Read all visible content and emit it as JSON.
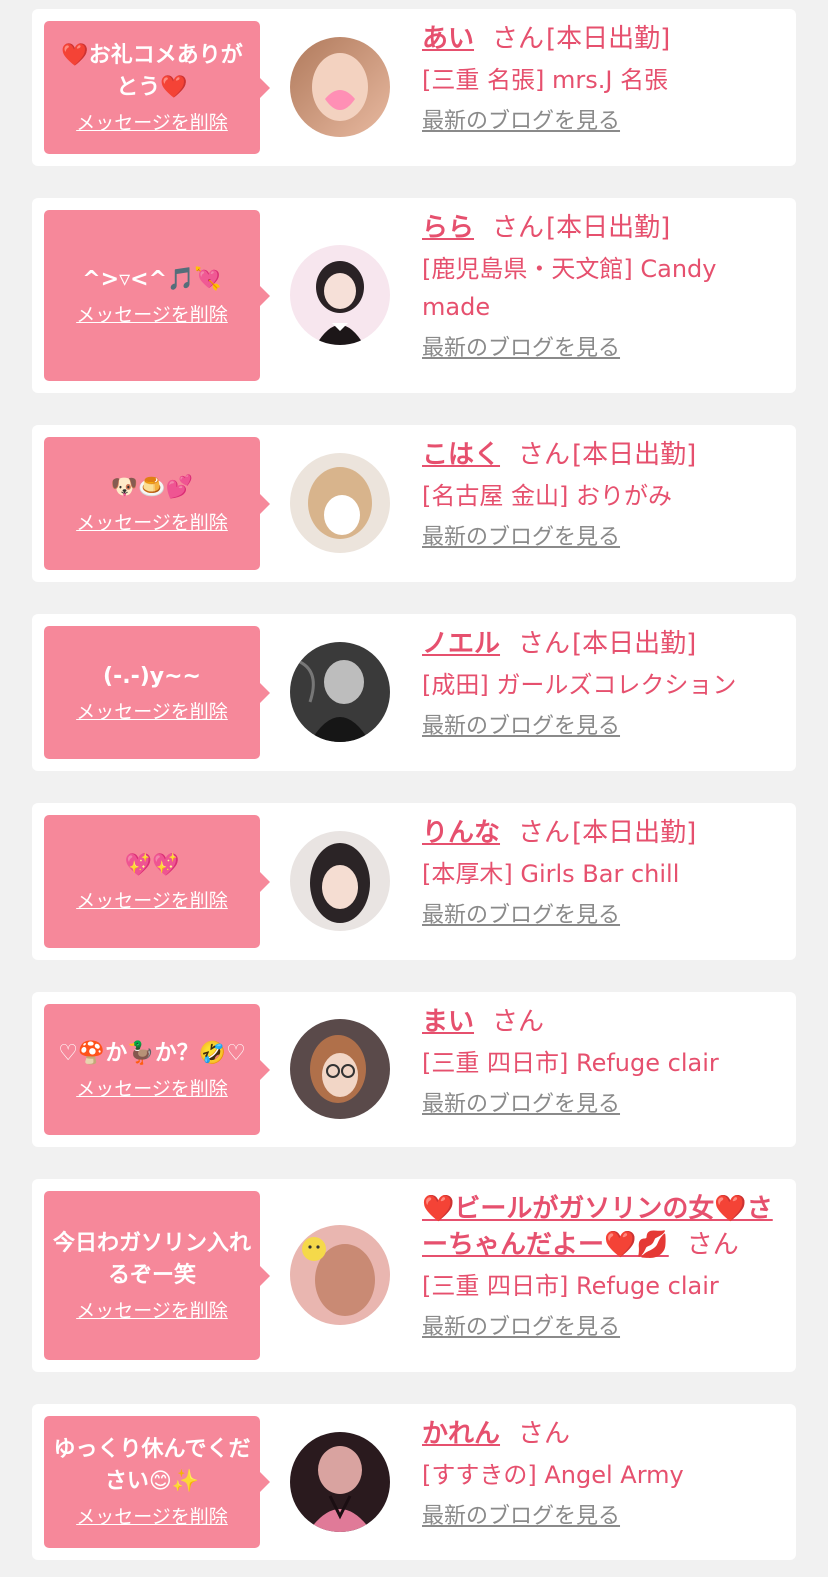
{
  "delete_label": "メッセージを削除",
  "san_label": "さん",
  "blog_label": "最新のブログを見る",
  "cards": [
    {
      "message": "❤️お礼コメありがとう❤️",
      "name": "あい",
      "status": "[本日出勤]",
      "shop": "[三重 名張] mrs.J 名張",
      "avatar_icon": "avatar-photo-pink-heart"
    },
    {
      "message": "^>▿<^🎵💘",
      "name": "らら",
      "status": "[本日出勤]",
      "shop": "[鹿児島県・天文館] Candy made",
      "avatar_icon": "avatar-photo-maid"
    },
    {
      "message": "🐶🍮💕",
      "name": "こはく",
      "status": "[本日出勤]",
      "shop": "[名古屋 金山] おりがみ",
      "avatar_icon": "avatar-photo-blonde"
    },
    {
      "message": "(-.-)y~~",
      "name": "ノエル",
      "status": "[本日出勤]",
      "shop": "[成田] ガールズコレクション",
      "avatar_icon": "avatar-photo-monochrome"
    },
    {
      "message": "💖💖",
      "name": "りんな",
      "status": "[本日出勤]",
      "shop": "[本厚木] Girls Bar chill",
      "avatar_icon": "avatar-photo-dark-hair"
    },
    {
      "message": "♡🍄か🦆か？🤣♡",
      "name": "まい",
      "status": "",
      "shop": "[三重 四日市] Refuge clair",
      "avatar_icon": "avatar-photo-glasses"
    },
    {
      "message": "今日わガソリン入れるぞー笑",
      "name": "❤️ビールがガソリンの女❤️さーちゃんだよー❤️💋",
      "status": "",
      "shop": "[三重 四日市] Refuge clair",
      "avatar_icon": "avatar-photo-smiley"
    },
    {
      "message": "ゆっくり休んでください😊✨",
      "name": "かれん",
      "status": "",
      "shop": "[すすきの] Angel Army",
      "avatar_icon": "avatar-photo-pink-outfit"
    }
  ],
  "colors": {
    "bubble": "#f6889a",
    "accent": "#e6506e",
    "link_gray": "#8a8a8a",
    "background": "#f1f1f1"
  }
}
